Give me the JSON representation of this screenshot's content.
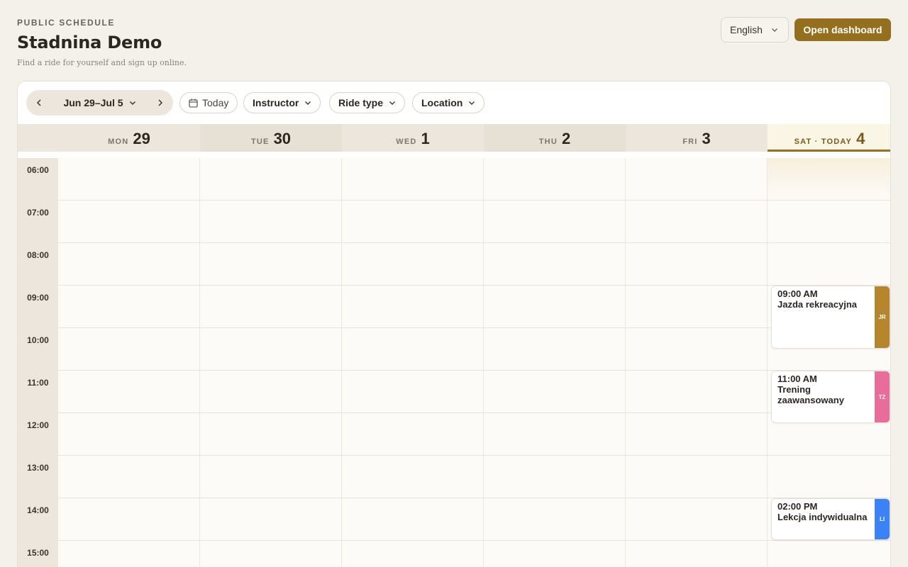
{
  "header": {
    "eyebrow": "PUBLIC SCHEDULE",
    "title": "Stadnina Demo",
    "subtitle": "Find a ride for yourself and sign up online.",
    "language": "English",
    "open_dashboard": "Open dashboard"
  },
  "toolbar": {
    "range_label": "Jun 29–Jul 5",
    "today_label": "Today",
    "filters": {
      "instructor": "Instructor",
      "ride_type": "Ride type",
      "location": "Location"
    }
  },
  "days": [
    {
      "name": "MON",
      "num": "29"
    },
    {
      "name": "TUE",
      "num": "30"
    },
    {
      "name": "WED",
      "num": "1"
    },
    {
      "name": "THU",
      "num": "2"
    },
    {
      "name": "FRI",
      "num": "3"
    },
    {
      "name": "SAT · TODAY",
      "num": "4"
    }
  ],
  "hours": [
    "06:00",
    "07:00",
    "08:00",
    "09:00",
    "10:00",
    "11:00",
    "12:00",
    "13:00",
    "14:00",
    "15:00"
  ],
  "events": [
    {
      "time": "09:00 AM",
      "title": "Jazda rekreacyjna",
      "tag": "JR",
      "color": "#b5862e"
    },
    {
      "time": "11:00 AM",
      "title": "Trening zaawansowany",
      "tag": "TZ",
      "color": "#e96d9a"
    },
    {
      "time": "02:00 PM",
      "title": "Lekcja indywidualna",
      "tag": "LI",
      "color": "#3b82f6"
    }
  ],
  "colors": {
    "accent": "#946f1e",
    "background": "#f4f1eb"
  }
}
